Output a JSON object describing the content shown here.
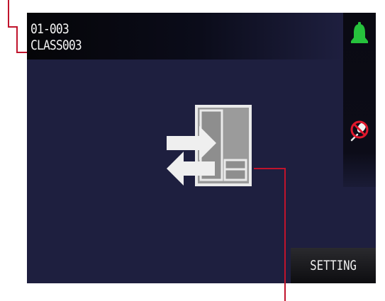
{
  "header": {
    "channel_number": "01-003",
    "channel_name": "CLASS003"
  },
  "status_panel": {
    "bell_icon": "bell-icon",
    "mic_icon": "mic-muted-icon"
  },
  "main": {
    "center_icon": "transfer-panel-icon"
  },
  "footer": {
    "setting_label": "SETTING"
  },
  "colors": {
    "screen_bg": "#1e1f3f",
    "header_bg": "#050508",
    "bell_green": "#26c23c",
    "mic_red": "#e0182d",
    "callout_line": "#c0142c",
    "icon_light": "#ececec",
    "icon_mid": "#9b9b9b"
  }
}
